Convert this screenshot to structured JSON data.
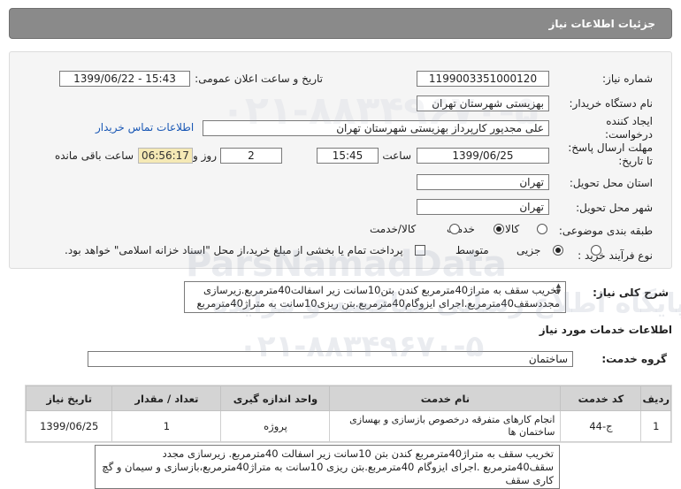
{
  "header": {
    "title": "جزئیات اطلاعات نیاز"
  },
  "form": {
    "need_number_label": "شماره نیاز:",
    "need_number": "1199003351000120",
    "announce_label": "تاریخ و ساعت اعلان عمومی:",
    "announce_value": "1399/06/22 - 15:43",
    "buyer_org_label": "نام دستگاه خریدار:",
    "buyer_org": "بهزیستی شهرستان تهران",
    "creator_label_1": "ایجاد کننده",
    "creator_label_2": "درخواست:",
    "creator_value": "علی  مجدپور کارپرداز  بهزیستی شهرستان تهران",
    "contact_link": "اطلاعات تماس خریدار",
    "deadline_label_1": "مهلت ارسال پاسخ:",
    "deadline_label_2": "تا تاریخ:",
    "deadline_date": "1399/06/25",
    "time_label": "ساعت",
    "deadline_time": "15:45",
    "days_value": "2",
    "days_label": "روز و",
    "remaining_time": "06:56:17",
    "remaining_label": "ساعت باقی مانده",
    "province_label": "استان محل تحویل:",
    "province_value": "تهران",
    "city_label": "شهر محل تحویل:",
    "city_value": "تهران",
    "category_label": "طبقه بندی موضوعی:",
    "category_options": [
      "کالا",
      "خدمت",
      "کالا/خدمت"
    ],
    "category_selected": "خدمت",
    "process_label": "نوع فرآیند خرید :",
    "process_options": [
      "جزیی",
      "متوسط"
    ],
    "process_selected": "متوسط",
    "payment_note": "پرداخت تمام یا بخشی از مبلغ خرید،از محل \"اسناد خزانه اسلامی\" خواهد بود."
  },
  "description": {
    "label": "شرح کلی نیاز:",
    "text": "تخریب سقف به متراژ40مترمربع کندن بتن10سانت زیر اسفالت40مترمربع.زیرسازی مجددسقف40مترمربع.اجرای ایزوگام40مترمربع.بتن ریزی10سانت به متراژ40مترمربع"
  },
  "services": {
    "section_title": "اطلاعات خدمات مورد نیاز",
    "group_label": "گروه خدمت:",
    "group_value": "ساختمان",
    "columns": [
      "ردیف",
      "کد خدمت",
      "نام خدمت",
      "واحد اندازه گیری",
      "تعداد / مقدار",
      "تاریخ نیاز"
    ],
    "rows": [
      {
        "index": "1",
        "code": "ج-44",
        "name": "انجام کارهای متفرقه درخصوص بازسازی و بهسازی ساختمان ها",
        "unit": "پروژه",
        "qty": "1",
        "date": "1399/06/25"
      }
    ]
  },
  "buyer_notes": {
    "text": "تخریب سقف به متراژ40مترمربع کندن بتن 10سانت زیر اسفالت 40مترمربع. زیرسازی مجدد سقف40مترمربع .اجرای ایزوگام 40مترمربع.بتن ریزی 10سانت به متراژ40مترمربع،بازسازی و سیمان و گچ کاری سقف"
  },
  "watermark": {
    "line1": "ParsNamadData",
    "line2": "پایگاه اطلاع رسانی مناقصه و مزایده",
    "line3": "۰۲۱-۸۸۳۴۹۶۷۰-۵"
  },
  "colors": {
    "title_bg": "#8a8a8a",
    "panel_bg": "#f5f5f5",
    "link": "#1a58b5",
    "remaining_bg": "#f5e9b5"
  }
}
